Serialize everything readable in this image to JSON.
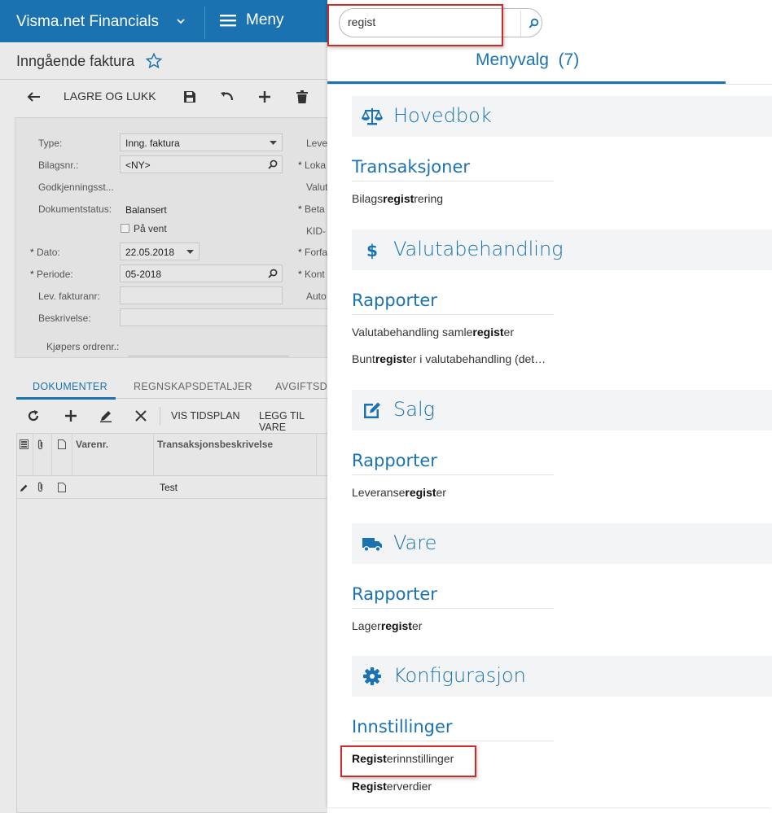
{
  "topbar": {
    "brand": "Visma.net Financials",
    "menu_label": "Meny"
  },
  "underlay": {
    "page_title": "Inngående faktura",
    "toolbar": {
      "save_close_label": "LAGRE OG LUKK"
    },
    "form": {
      "type_label": "Type:",
      "type_value": "Inng. faktura",
      "doc_no_label": "Bilagsnr.:",
      "doc_no_value": "<NY>",
      "approval_label": "Godkjenningsst...",
      "status_label": "Dokumentstatus:",
      "status_value": "Balansert",
      "on_hold_label": "På vent",
      "date_label": "Dato:",
      "date_value": "22.05.2018",
      "period_label": "Periode:",
      "period_value": "05-2018",
      "supp_inv_label": "Lev. fakturanr:",
      "desc_label": "Beskrivelse:",
      "buyer_order_label": "Kjøpers ordrenr.:",
      "right_labels": [
        "Leve",
        "Loka",
        "Valut",
        "Beta",
        "KID-",
        "Forfa",
        "Kont",
        "Auto"
      ]
    },
    "tabs": [
      "DOKUMENTER",
      "REGNSKAPSDETALJER",
      "AVGIFTSDE"
    ],
    "grid_toolbar": {
      "schedule": "VIS TIDSPLAN",
      "add_item": "LEGG TIL VARE"
    },
    "grid": {
      "col_item_no": "Varenr.",
      "col_desc": "Transaksjonsbeskrivelse",
      "row_desc": "Test"
    }
  },
  "panel": {
    "search_value": "regist",
    "title": "Menyvalg",
    "count": "(7)",
    "sections": {
      "hovedbok": {
        "label": "Hovedbok",
        "sub": "Transaksjoner",
        "items": [
          {
            "pre": "Bilags",
            "hl": "regist",
            "post": "rering"
          }
        ]
      },
      "valuta": {
        "label": "Valutabehandling",
        "sub": "Rapporter",
        "items": [
          {
            "pre": "Valutabehandling samle",
            "hl": "regist",
            "post": "er"
          },
          {
            "pre": "Bunt",
            "hl": "regist",
            "post": "er i valutabehandling (det…"
          }
        ]
      },
      "salg": {
        "label": "Salg",
        "sub": "Rapporter",
        "items": [
          {
            "pre": "Leveranse",
            "hl": "regist",
            "post": "er"
          }
        ]
      },
      "vare": {
        "label": "Vare",
        "sub": "Rapporter",
        "items": [
          {
            "pre": "Lager",
            "hl": "regist",
            "post": "er"
          }
        ]
      },
      "konfig": {
        "label": "Konfigurasjon",
        "sub": "Innstillinger",
        "items": [
          {
            "pre": "",
            "hl": "Regist",
            "post": "erinnstillinger"
          },
          {
            "pre": "",
            "hl": "Regist",
            "post": "erverdier"
          }
        ]
      }
    },
    "colors": {
      "accent": "#1a73b0",
      "highlight_box": "#cc2b2b"
    }
  }
}
